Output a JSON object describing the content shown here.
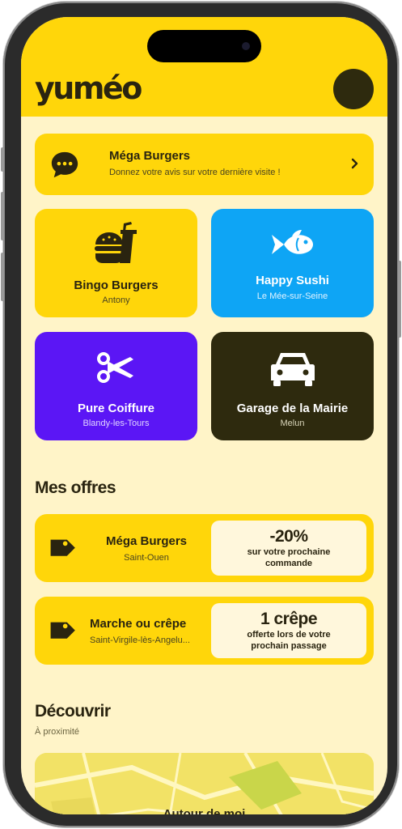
{
  "header": {
    "logo": "yuméo"
  },
  "review_prompt": {
    "title": "Méga Burgers",
    "subtitle": "Donnez votre avis sur votre dernière visite !"
  },
  "favorites": [
    {
      "name": "Bingo Burgers",
      "city": "Antony",
      "icon": "burger-drink-icon",
      "color": "#FFD60A"
    },
    {
      "name": "Happy Sushi",
      "city": "Le Mée-sur-Seine",
      "icon": "fish-icon",
      "color": "#0EA5F5"
    },
    {
      "name": "Pure Coiffure",
      "city": "Blandy-les-Tours",
      "icon": "scissors-icon",
      "color": "#5B16F5"
    },
    {
      "name": "Garage de la Mairie",
      "city": "Melun",
      "icon": "car-icon",
      "color": "#2E2A0E"
    }
  ],
  "offers_section": {
    "title": "Mes offres"
  },
  "offers": [
    {
      "name": "Méga Burgers",
      "city": "Saint-Ouen",
      "value": "-20%",
      "description_line1": "sur votre prochaine",
      "description_line2": "commande"
    },
    {
      "name": "Marche ou crêpe",
      "city": "Saint-Virgile-lès-Angelu...",
      "value": "1 crêpe",
      "description_line1": "offerte lors de votre",
      "description_line2": "prochain passage"
    }
  ],
  "discover_section": {
    "title": "Découvrir",
    "subtitle": "À proximité"
  },
  "map": {
    "label": "Autour de moi"
  },
  "colors": {
    "accent": "#FFD60A",
    "background": "#FFF4C8",
    "dark": "#2E2A0E"
  }
}
